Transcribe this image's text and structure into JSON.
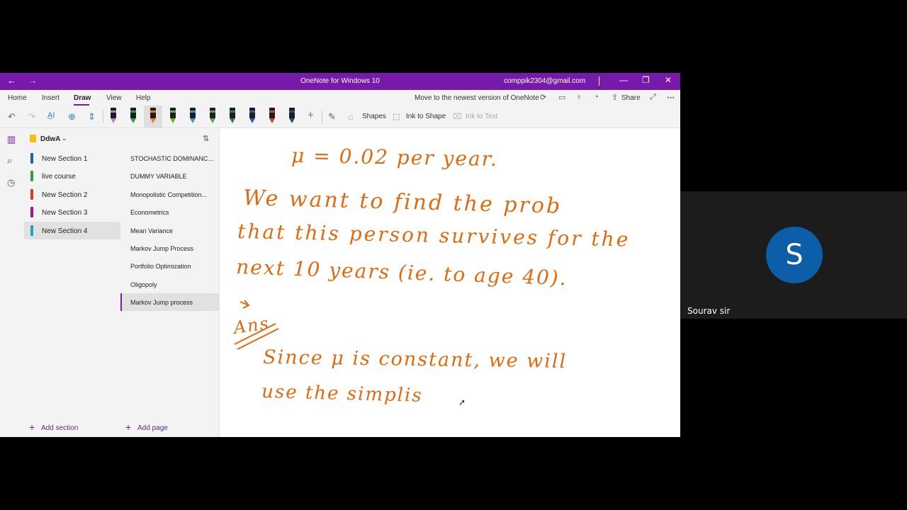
{
  "window": {
    "title": "OneNote for Windows 10",
    "account": "comppik2304@gmail.com",
    "back_glyph": "←",
    "forward_glyph": "→",
    "minimize_glyph": "—",
    "restore_glyph": "❐",
    "close_glyph": "✕"
  },
  "menu": {
    "tabs": [
      "Home",
      "Insert",
      "Draw",
      "View",
      "Help"
    ],
    "active_tab": "Draw",
    "upgrade_link": "Move to the newest version of OneNote",
    "share_label": "Share"
  },
  "toolbar": {
    "shapes_label": "Shapes",
    "ink_to_shape_label": "Ink to Shape",
    "ink_to_text_label": "Ink to Text",
    "pen_colors": [
      "#b07fd6",
      "#2e9e3f",
      "#ef7a25",
      "#5bb83a",
      "#3b8ede",
      "#49a85b",
      "#2b7f59",
      "#2f5fa6",
      "#d93b2b",
      "#2b4b8f"
    ],
    "selected_pen_color": "#ef7a25"
  },
  "notebook": {
    "name": "DdwA",
    "sections": [
      {
        "label": "New Section 1",
        "color": "#1f5fa6"
      },
      {
        "label": "live course",
        "color": "#2e9e3f"
      },
      {
        "label": "New Section 2",
        "color": "#d93b2b"
      },
      {
        "label": "New Section 3",
        "color": "#a31592"
      },
      {
        "label": "New Section 4",
        "color": "#1ea3c8"
      }
    ],
    "selected_section": "New Section 4",
    "add_section_label": "Add section",
    "pages": [
      "STOCHASTIC DOMINANCE...",
      "DUMMY VARIABLE",
      "Monopolistic Competition...",
      "Econometrics",
      "Mean Variance",
      "Markov Jump Process",
      "Portfolio Optimization",
      "Oligopoly",
      "Markov Jump process"
    ],
    "selected_page": "Markov Jump process",
    "add_page_label": "Add page"
  },
  "ink": {
    "color": "#e06a10",
    "lines": [
      "μ = 0.02 per year.",
      "We want to find the prob",
      "that this person survives for the",
      "next 10 years (ie. to age 40).",
      "Ans",
      "Since μ is constant, we will",
      "use the simplis"
    ]
  },
  "participant": {
    "initial": "S",
    "name": "Sourav sir",
    "avatar_color": "#0d5ea8"
  }
}
